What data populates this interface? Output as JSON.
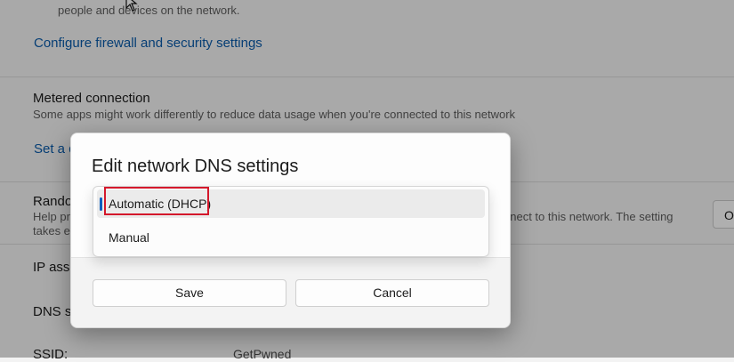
{
  "background": {
    "network_discovery_desc": "people and devices on the network.",
    "firewall_link": "Configure firewall and security settings",
    "metered_title": "Metered connection",
    "metered_desc": "Some apps might work differently to reduce data usage when you're connected to this network",
    "data_limit_link": "Set a d",
    "random_title": "Rando",
    "random_desc_1": "Help pr",
    "random_desc_2": "takes ef",
    "random_desc_right": "nnect to this network. The setting",
    "random_toggle_label": "Of",
    "ip_label": "IP assig",
    "dns_label": "DNS se",
    "ssid_label": "SSID:",
    "ssid_value": "GetPwned"
  },
  "dialog": {
    "title": "Edit network DNS settings",
    "options": [
      {
        "label": "Automatic (DHCP)",
        "selected": true
      },
      {
        "label": "Manual",
        "selected": false
      }
    ],
    "save_label": "Save",
    "cancel_label": "Cancel"
  },
  "colors": {
    "accent": "#0b5fc0",
    "highlight": "#d4182b",
    "link": "#0a5aa8"
  }
}
